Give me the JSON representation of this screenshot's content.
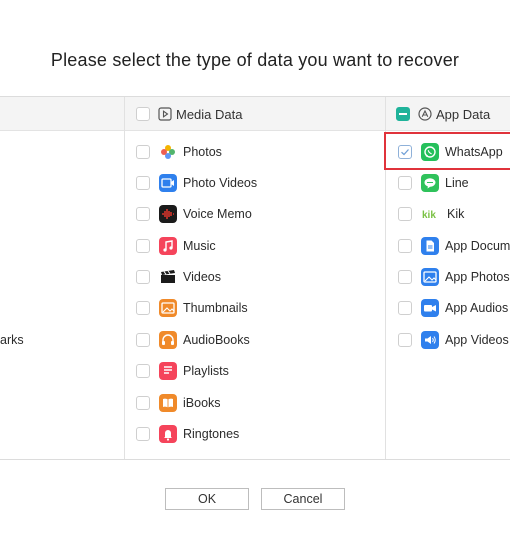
{
  "dialog": {
    "title": "Please select the type of data you want to recover",
    "left_partial_item": "arks"
  },
  "columns": {
    "media": {
      "header": "Media Data",
      "icon": "media-play-icon"
    },
    "app": {
      "header": "App Data",
      "icon": "app-store-icon"
    }
  },
  "media_items": [
    {
      "label": "Photos",
      "icon": "photos-icon",
      "color": "#f4b400"
    },
    {
      "label": "Photo Videos",
      "icon": "photo-videos-icon",
      "color": "#2f80ed"
    },
    {
      "label": "Voice Memo",
      "icon": "voice-memo-icon",
      "color": "#1b1b1b"
    },
    {
      "label": "Music",
      "icon": "music-icon",
      "color": "#f5445b"
    },
    {
      "label": "Videos",
      "icon": "videos-icon",
      "color": "#1b1b1b"
    },
    {
      "label": "Thumbnails",
      "icon": "thumbnails-icon",
      "color": "#f08a2a"
    },
    {
      "label": "AudioBooks",
      "icon": "audiobooks-icon",
      "color": "#f08a2a"
    },
    {
      "label": "Playlists",
      "icon": "playlists-icon",
      "color": "#f5445b"
    },
    {
      "label": "iBooks",
      "icon": "ibooks-icon",
      "color": "#f08a2a"
    },
    {
      "label": "Ringtones",
      "icon": "ringtones-icon",
      "color": "#f5445b"
    }
  ],
  "app_items": [
    {
      "label": "WhatsApp",
      "icon": "whatsapp-icon",
      "color": "#25c05b",
      "checked": true
    },
    {
      "label": "Line",
      "icon": "line-icon",
      "color": "#2fc25b",
      "checked": false
    },
    {
      "label": "Kik",
      "icon": "kik-icon",
      "color": "#ffffff",
      "checked": false
    },
    {
      "label": "App Docum",
      "icon": "app-documents-icon",
      "color": "#2f80ed",
      "checked": false
    },
    {
      "label": "App Photos",
      "icon": "app-photos-icon",
      "color": "#2f80ed",
      "checked": false
    },
    {
      "label": "App Audios",
      "icon": "app-audios-icon",
      "color": "#2f80ed",
      "checked": false
    },
    {
      "label": "App Videos",
      "icon": "app-videos-icon",
      "color": "#2f80ed",
      "checked": false
    }
  ],
  "buttons": {
    "ok": "OK",
    "cancel": "Cancel"
  },
  "colors": {
    "accent": "#1fb39a",
    "highlight": "#e0333b"
  }
}
